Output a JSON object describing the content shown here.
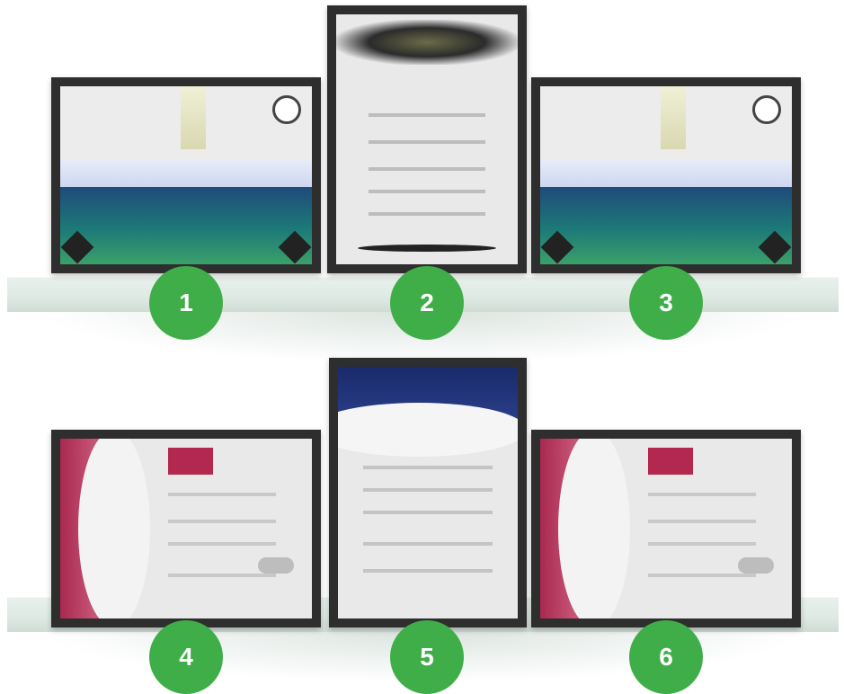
{
  "badges": [
    "1",
    "2",
    "3",
    "4",
    "5",
    "6"
  ],
  "colors": {
    "badge": "#3fae49",
    "frame": "#2e2e2e",
    "shelf": "#dfeae4"
  },
  "certificates": [
    {
      "style": "green-landscape"
    },
    {
      "style": "ornate-portrait"
    },
    {
      "style": "green-landscape"
    },
    {
      "style": "pink-landscape"
    },
    {
      "style": "blue-portrait"
    },
    {
      "style": "pink-landscape"
    }
  ]
}
